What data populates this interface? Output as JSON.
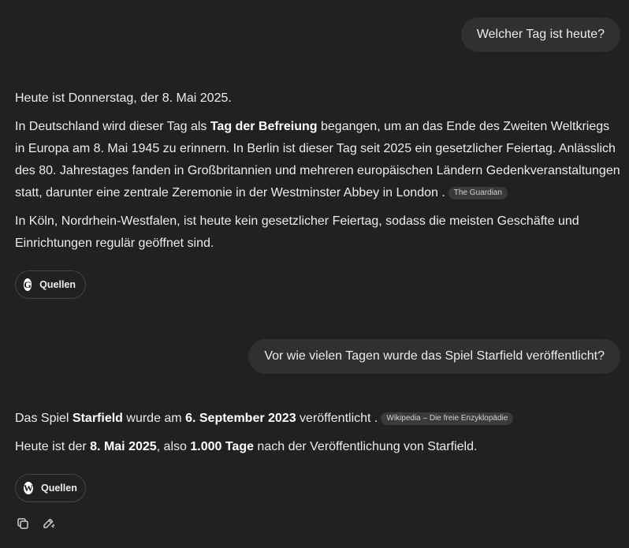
{
  "conversation": {
    "turn1": {
      "user_message": "Welcher Tag ist heute?",
      "p1": "Heute ist Donnerstag, der 8. Mai 2025.",
      "p2_a": "In Deutschland wird dieser Tag als ",
      "p2_bold": "Tag der Befreiung",
      "p2_b": " begangen, um an das Ende des Zweiten Weltkriegs in Europa am 8. Mai 1945 zu erinnern. In Berlin ist dieser Tag seit 2025 ein gesetzlicher Feiertag. Anlässlich des 80. Jahrestages fanden in Großbritannien und mehreren europäischen Ländern Gedenkveranstaltungen statt, darunter eine zentrale Zeremonie in der Westminster Abbey in London .",
      "p2_citation": "The Guardian",
      "p3": "In Köln, Nordrhein-Westfalen, ist heute kein gesetzlicher Feiertag, sodass die meisten Geschäfte und Einrichtungen regulär geöffnet sind.",
      "sources_label": "Quellen",
      "sources_icon": "guardian-logo-icon"
    },
    "turn2": {
      "user_message": "Vor wie vielen Tagen wurde das Spiel Starfield veröffentlicht?",
      "p1_a": "Das Spiel ",
      "p1_bold1": "Starfield",
      "p1_b": " wurde am ",
      "p1_bold2": "6. September 2023",
      "p1_c": " veröffentlicht .",
      "p1_citation": "Wikipedia – Die freie Enzyklopädie",
      "p2_a": "Heute ist der ",
      "p2_bold1": "8. Mai 2025",
      "p2_b": ", also ",
      "p2_bold2": "1.000 Tage",
      "p2_c": " nach der Veröffentlichung von Starfield.",
      "sources_label": "Quellen",
      "sources_icon": "wikipedia-logo-icon"
    }
  },
  "actions": {
    "copy_icon": "copy-icon",
    "edit_icon": "edit-icon"
  },
  "colors": {
    "background": "#212121",
    "user_bubble": "#303030",
    "text": "#ececec"
  }
}
